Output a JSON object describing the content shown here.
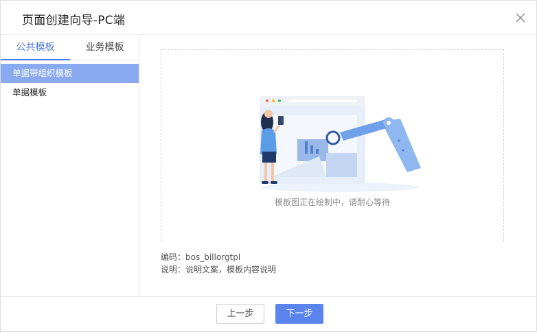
{
  "dialog": {
    "title": "页面创建向导-PC端"
  },
  "tabs": [
    {
      "label": "公共模板",
      "active": true
    },
    {
      "label": "业务模板",
      "active": false
    }
  ],
  "template_list": [
    {
      "label": "单据带组织模板",
      "selected": true
    },
    {
      "label": "单据模板",
      "selected": false
    }
  ],
  "preview": {
    "caption": "模板图正在绘制中，请耐心等待",
    "illustration": "robot-arm-drawing-illustration"
  },
  "meta": {
    "code": "编码：bos_billorgtpl",
    "description": "说明：说明文案，模板内容说明"
  },
  "footer": {
    "prev_label": "上一步",
    "next_label": "下一步"
  },
  "colors": {
    "accent": "#4a78e8",
    "selected_bg": "#89a9f0",
    "primary_button": "#5b85ee"
  }
}
